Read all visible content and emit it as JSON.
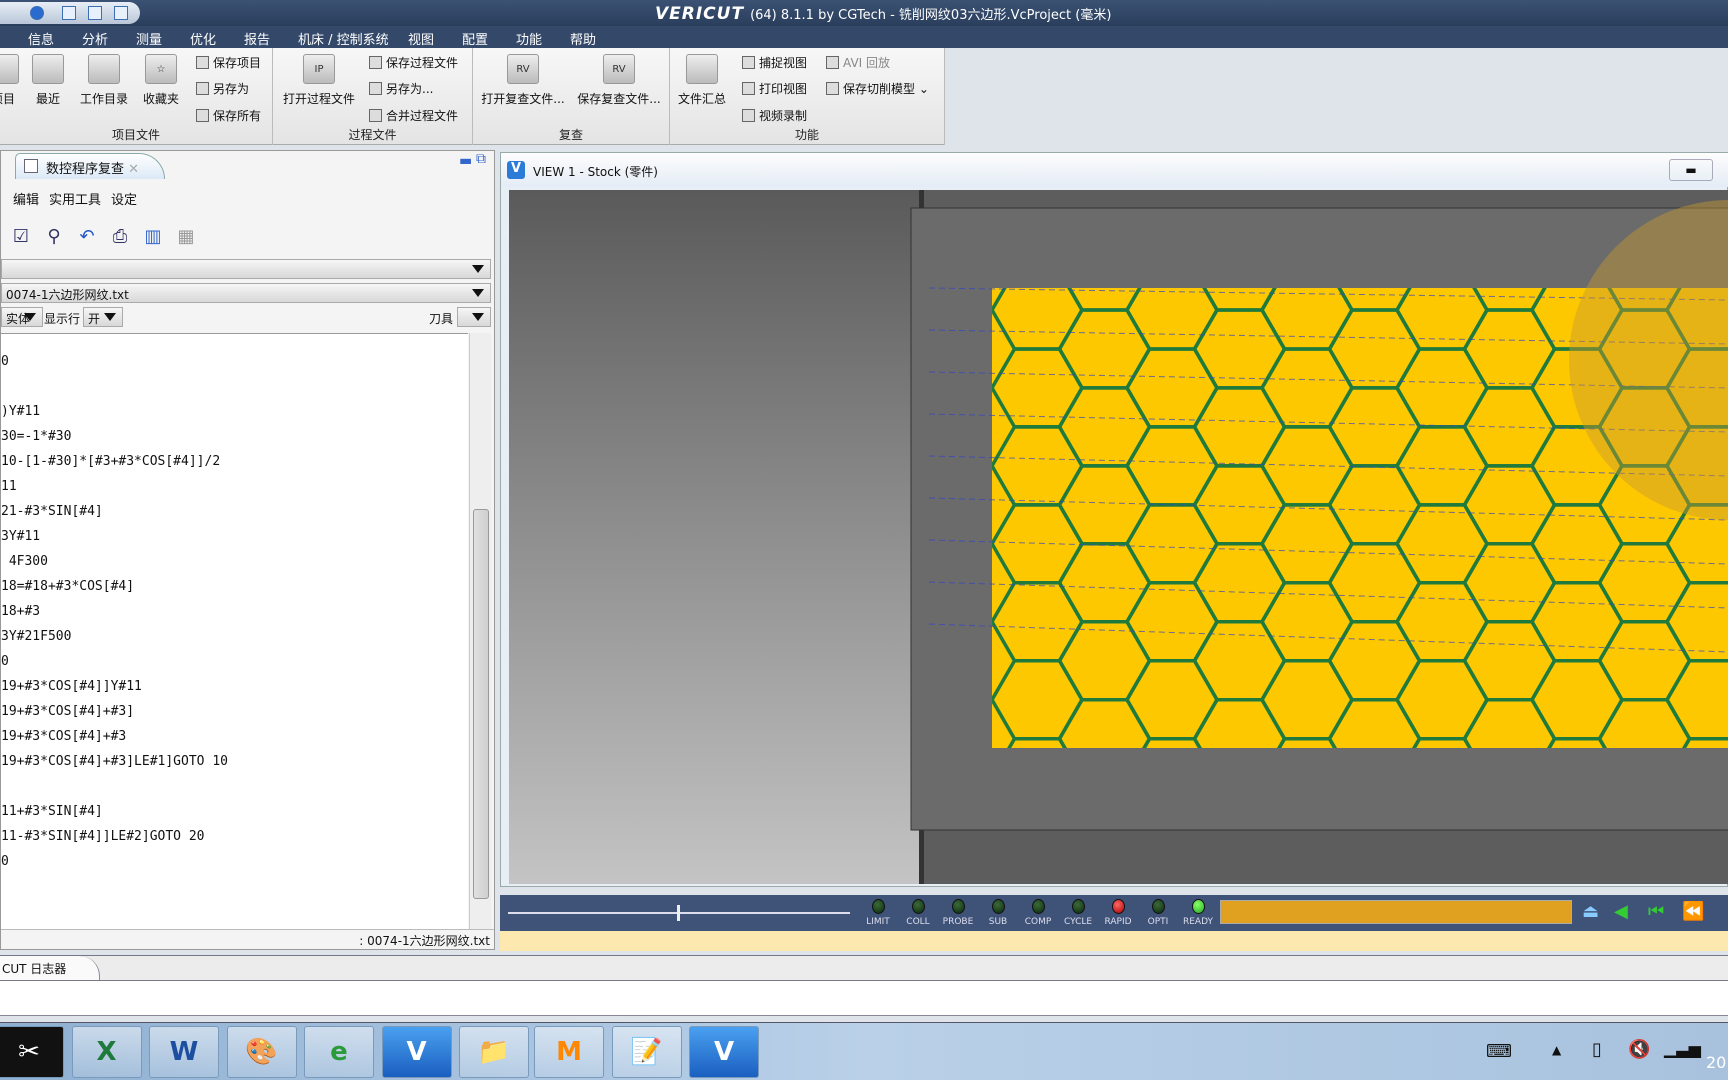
{
  "titlebar": {
    "app": "VERICUT",
    "title": "(64)  8.1.1 by CGTech - 铣削网纹03六边形.VcProject (毫米)"
  },
  "menubar": [
    "信息",
    "分析",
    "测量",
    "优化",
    "报告",
    "机床 / 控制系统",
    "视图",
    "配置",
    "功能",
    "帮助"
  ],
  "ribbon": {
    "groups": [
      {
        "label": "项目文件"
      },
      {
        "label": "过程文件"
      },
      {
        "label": "复查"
      },
      {
        "label": "功能"
      }
    ],
    "project": {
      "item_partial": "项目",
      "recent": "最近",
      "workdir": "工作目录",
      "favorites": "收藏夹",
      "save_project": "保存项目",
      "save_as": "另存为",
      "save_all": "保存所有"
    },
    "process": {
      "open": "打开过程文件",
      "save": "保存过程文件",
      "save_as": "另存为...",
      "merge": "合并过程文件"
    },
    "review": {
      "open": "打开复查文件...",
      "save": "保存复查文件..."
    },
    "function": {
      "summary": "文件汇总",
      "capture": "捕捉视图",
      "print": "打印视图",
      "record": "视频录制",
      "avi": "AVI 回放",
      "save_model": "保存切削模型"
    }
  },
  "left_panel": {
    "tab": "数控程序复查",
    "menu": [
      "编辑",
      "实用工具",
      "设定"
    ],
    "file": "0074-1六边形网纹.txt",
    "mode": "实体",
    "show_line_label": "显示行",
    "show_line_value": "开",
    "tool_label": "刀具",
    "code_lines": [
      "0",
      "",
      ")Y#11",
      "30=-1*#30",
      "10-[1-#30]*[#3+#3*COS[#4]]/2",
      "11",
      "21-#3*SIN[#4]",
      "3Y#11",
      " 4F300",
      "18=#18+#3*COS[#4]",
      "18+#3",
      "3Y#21F500",
      "0",
      "19+#3*COS[#4]]Y#11",
      "19+#3*COS[#4]+#3]",
      "19+#3*COS[#4]+#3",
      "19+#3*COS[#4]+#3]LE#1]GOTO 10",
      "",
      "11+#3*SIN[#4]",
      "11-#3*SIN[#4]]LE#2]GOTO 20",
      "0"
    ],
    "status": ": 0074-1六边形网纹.txt"
  },
  "view": {
    "title": "VIEW 1 - Stock (零件)",
    "stock_color": "#fdc800",
    "hex_color": "#1f7a3c"
  },
  "controls": {
    "leds": [
      {
        "label": "LIMIT",
        "color": "off"
      },
      {
        "label": "COLL",
        "color": "off"
      },
      {
        "label": "PROBE",
        "color": "off"
      },
      {
        "label": "SUB",
        "color": "off"
      },
      {
        "label": "COMP",
        "color": "off"
      },
      {
        "label": "CYCLE",
        "color": "off"
      },
      {
        "label": "RAPID",
        "color": "red"
      },
      {
        "label": "OPTI",
        "color": "off"
      },
      {
        "label": "READY",
        "color": "green"
      }
    ],
    "progress_color": "#e0a020"
  },
  "log": {
    "tab": "CUT 日志器"
  },
  "taskbar": {
    "apps": [
      "capcut-icon",
      "excel-icon",
      "word-icon",
      "paint-icon",
      "ie-icon",
      "vericut-icon",
      "explorer-icon",
      "mastercam-icon",
      "notepad-icon",
      "vericut-icon"
    ],
    "clock_partial": "20"
  }
}
